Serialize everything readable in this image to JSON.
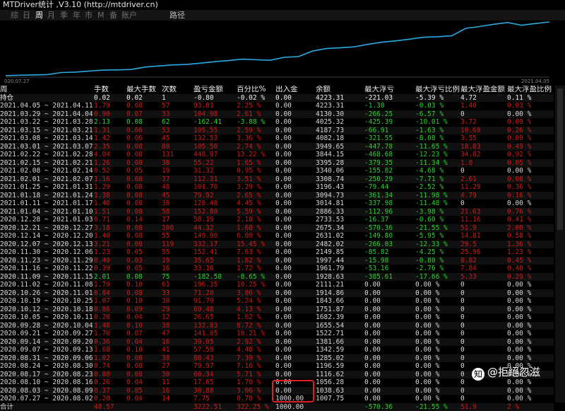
{
  "window": {
    "title": "MTDriver统计 ,V3.10 (http://mtdriver.cn)"
  },
  "tabs": [
    {
      "label": "综",
      "active": false
    },
    {
      "label": "日",
      "active": false
    },
    {
      "label": "周",
      "active": true
    },
    {
      "label": "月",
      "active": false
    },
    {
      "label": "季",
      "active": false
    },
    {
      "label": "年",
      "active": false
    },
    {
      "label": "市",
      "active": false
    },
    {
      "label": "M",
      "active": false
    },
    {
      "label": "备",
      "active": false
    },
    {
      "label": "账户",
      "active": false
    }
  ],
  "extra_tab": "路径",
  "equity_chart": {
    "start_label": "020.07.27",
    "end_label": "2021.04.05",
    "line_color": "#2aa9e0",
    "values": [
      1007.75,
      1038.63,
      1056.28,
      1075.0,
      1196.59,
      1224.6,
      1285.02,
      1342.59,
      1355.32,
      1381.66,
      1522.71,
      1590.53,
      1655.54,
      1682.39,
      1759.66,
      1843.66,
      1914.86,
      1997.03,
      1961.79,
      1928.63,
      2111.21,
      2149.85,
      2482.02,
      2631.02,
      2675.34,
      2733.53,
      2886.33,
      3014.81,
      3094.73,
      3196.43,
      3308.74,
      3340.06,
      3395.28,
      3844.15,
      3949.65,
      4082.18,
      4187.73,
      4025.32,
      4130.3,
      4223.31
    ]
  },
  "table": {
    "headers": [
      "周",
      "手数",
      "最大手数",
      "次数",
      "盈亏金额",
      "百分比%",
      "出入金",
      "余额",
      "最大浮亏",
      "最大浮亏比例",
      "最大浮盈金额",
      "最大浮盈比例"
    ],
    "holding": [
      "持仓",
      "0.02",
      "0.02",
      "1",
      "-0.80",
      "-0.02 %",
      "0.00",
      "4223.31",
      "-221.03",
      "-5.39 %",
      "4.72",
      "0.11 %"
    ],
    "rows": [
      [
        "2021.04.05 ~ 2021.04.11",
        "1.79",
        "0.08",
        "57",
        "93.01",
        "2.25 %",
        "0.00",
        "4223.31",
        "-1.30",
        "-0.03 %",
        "1.40",
        "0.03 %"
      ],
      [
        "2021.03.29 ~ 2021.04.04",
        "0.90",
        "0.07",
        "33",
        "104.98",
        "2.61 %",
        "0.00",
        "4130.30",
        "-266.25",
        "-6.57 %",
        "0",
        "0.00 %"
      ],
      [
        "2021.03.22 ~ 2021.03.28",
        "2.13",
        "0.08",
        "62",
        "-162.41",
        "-3.88 %",
        "0.00",
        "4025.32",
        "-425.39",
        "-10.01 %",
        "3.72",
        "0.09 %"
      ],
      [
        "2021.03.15 ~ 2021.03.21",
        "1.31",
        "0.06",
        "53",
        "105.55",
        "2.59 %",
        "0.00",
        "4187.73",
        "-66.91",
        "-1.63 %",
        "10.69",
        "0.26 %"
      ],
      [
        "2021.03.08 ~ 2021.03.14",
        "1.42",
        "0.06",
        "45",
        "132.53",
        "3.36 %",
        "0.00",
        "4082.18",
        "-321.55",
        "-8.08 %",
        "3.55",
        "0.09 %"
      ],
      [
        "2021.03.01 ~ 2021.03.07",
        "2.35",
        "0.08",
        "80",
        "105.50",
        "2.74 %",
        "0.00",
        "3949.65",
        "-447.78",
        "-11.65 %",
        "18.83",
        "0.49 %"
      ],
      [
        "2021.02.22 ~ 2021.02.28",
        "4.04",
        "0.08",
        "131",
        "448.87",
        "13.22 %",
        "0.00",
        "3844.15",
        "-468.68",
        "-12.23 %",
        "34.82",
        "0.92 %"
      ],
      [
        "2021.02.15 ~ 2021.02.21",
        "1.26",
        "0.08",
        "38",
        "55.22",
        "1.65 %",
        "0.00",
        "3395.28",
        "-379.35",
        "-11.34 %",
        "1.8",
        "0.05 %"
      ],
      [
        "2021.02.08 ~ 2021.02.14",
        "0.52",
        "0.05",
        "19",
        "31.32",
        "0.95 %",
        "0.00",
        "3340.06",
        "-155.82",
        "-4.68 %",
        "0",
        "0.00 %"
      ],
      [
        "2021.02.01 ~ 2021.02.07",
        "1.16",
        "0.08",
        "37",
        "112.31",
        "3.51 %",
        "0.00",
        "3308.74",
        "-250.29",
        "-7.71 %",
        "2.61",
        "0.08 %"
      ],
      [
        "2021.01.25 ~ 2021.01.31",
        "1.29",
        "0.08",
        "48",
        "101.70",
        "3.29 %",
        "0.00",
        "3196.43",
        "-79.44",
        "-2.52 %",
        "11.29",
        "0.36 %"
      ],
      [
        "2021.01.18 ~ 2021.01.24",
        "1.38",
        "0.08",
        "45",
        "79.92",
        "2.65 %",
        "0.00",
        "3094.73",
        "-361.34",
        "-11.98 %",
        "4.79",
        "0.16 %"
      ],
      [
        "2021.01.11 ~ 2021.01.17",
        "1.46",
        "0.08",
        "38",
        "128.48",
        "4.45 %",
        "0.00",
        "3014.81",
        "-337.98",
        "-11.48 %",
        "0",
        "0.00 %"
      ],
      [
        "2021.01.04 ~ 2021.01.10",
        "1.51",
        "0.08",
        "58",
        "152.80",
        "5.59 %",
        "0.00",
        "2886.33",
        "-112.96",
        "-3.98 %",
        "21.63",
        "0.76 %"
      ],
      [
        "2020.12.28 ~ 2021.01.03",
        "0.71",
        "0.14",
        "17",
        "58.19",
        "2.18 %",
        "0.00",
        "2733.53",
        "-16.37",
        "-0.60 %",
        "11.16",
        "0.41 %"
      ],
      [
        "2020.12.21 ~ 2020.12.27",
        "3.18",
        "0.08",
        "106",
        "44.32",
        "1.68 %",
        "0.00",
        "2675.34",
        "-570.36",
        "-21.55 %",
        "51.9",
        "2.00 %"
      ],
      [
        "2020.12.14 ~ 2020.12.20",
        "1.40",
        "0.08",
        "55",
        "149.00",
        "6.00 %",
        "0.00",
        "2631.02",
        "-149.80",
        "-5.95 %",
        "14.81",
        "0.58 %"
      ],
      [
        "2020.12.07 ~ 2020.12.13",
        "3.21",
        "0.08",
        "119",
        "332.17",
        "15.45 %",
        "0.00",
        "2482.02",
        "-266.03",
        "-12.33 %",
        "29.5",
        "1.36 %"
      ],
      [
        "2020.11.30 ~ 2020.12.06",
        "1.23",
        "0.05",
        "55",
        "152.41",
        "7.63 %",
        "0.00",
        "2149.85",
        "-85.82",
        "-4.25 %",
        "25.96",
        "1.23 %"
      ],
      [
        "2020.11.23 ~ 2020.11.29",
        "0.40",
        "0.03",
        "19",
        "35.65",
        "1.82 %",
        "0.00",
        "1997.44",
        "-15.98",
        "-0.80 %",
        "8.82",
        "0.45 %"
      ],
      [
        "2020.11.16 ~ 2020.11.22",
        "0.39",
        "0.05",
        "16",
        "33.16",
        "1.72 %",
        "0.00",
        "1961.79",
        "-53.16",
        "-2.76 %",
        "7.84",
        "0.40 %"
      ],
      [
        "2020.11.09 ~ 2020.11.15",
        "2.01",
        "0.08",
        "75",
        "-182.58",
        "-8.65 %",
        "0.00",
        "1928.63",
        "-385.61",
        "-17.66 %",
        "5.33",
        "0.29 %"
      ],
      [
        "2020.11.02 ~ 2020.11.08",
        "1.79",
        "0.10",
        "61",
        "196.35",
        "10.25 %",
        "0.00",
        "2111.21",
        "0.00",
        "0.00 %",
        "0",
        "0.00 %"
      ],
      [
        "2020.10.26 ~ 2020.11.01",
        "0.84",
        "0.08",
        "33",
        "71.20",
        "3.86 %",
        "0.00",
        "1914.86",
        "0.00",
        "0.00 %",
        "0",
        "0.00 %"
      ],
      [
        "2020.10.19 ~ 2020.10.25",
        "1.07",
        "0.10",
        "30",
        "91.79",
        "5.24 %",
        "0.00",
        "1843.66",
        "0.00",
        "0.00 %",
        "0",
        "0.00 %"
      ],
      [
        "2020.10.12 ~ 2020.10.18",
        "0.86",
        "0.09",
        "29",
        "69.48",
        "4.13 %",
        "0.00",
        "1751.87",
        "0.00",
        "0.00 %",
        "0",
        "0.00 %"
      ],
      [
        "2020.10.05 ~ 2020.10.11",
        "0.28",
        "0.04",
        "12",
        "26.65",
        "1.62 %",
        "0.00",
        "1682.39",
        "0.00",
        "0.00 %",
        "0",
        "0.00 %"
      ],
      [
        "2020.09.28 ~ 2020.10.04",
        "1.48",
        "0.10",
        "38",
        "132.83",
        "8.72 %",
        "0.00",
        "1655.54",
        "0.00",
        "0.00 %",
        "0",
        "0.00 %"
      ],
      [
        "2020.09.21 ~ 2020.09.27",
        "1.70",
        "0.07",
        "47",
        "141.05",
        "10.21 %",
        "0.00",
        "1522.71",
        "0.00",
        "0.00 %",
        "0",
        "0.00 %"
      ],
      [
        "2020.09.14 ~ 2020.09.20",
        "0.36",
        "0.04",
        "16",
        "39.05",
        "2.92 %",
        "0.00",
        "1381.66",
        "0.00",
        "0.00 %",
        "0",
        "0.00 %"
      ],
      [
        "2020.09.07 ~ 2020.09.13",
        "1.68",
        "0.10",
        "41",
        "57.59",
        "4.48 %",
        "0.00",
        "1342.59",
        "0.00",
        "0.00 %",
        "0",
        "0.00 %"
      ],
      [
        "2020.08.31 ~ 2020.09.06",
        "1.02",
        "0.08",
        "38",
        "88.43",
        "7.39 %",
        "0.00",
        "1285.02",
        "0.00",
        "0.00 %",
        "0",
        "0.00 %"
      ],
      [
        "2020.08.24 ~ 2020.08.30",
        "0.74",
        "0.08",
        "27",
        "79.97",
        "7.16 %",
        "0.00",
        "1196.59",
        "0.00",
        "0.00 %",
        "0",
        "0.00 %"
      ],
      [
        "2020.08.17 ~ 2020.08.23",
        "0.80",
        "0.08",
        "30",
        "60.34",
        "5.71 %",
        "0.00",
        "1116.62",
        "0.00",
        "0.00 %",
        "0",
        "0.00 %"
      ],
      [
        "2020.08.10 ~ 2020.08.16",
        "0.26",
        "0.04",
        "11",
        "17.65",
        "1.70 %",
        "0.00",
        "1056.28",
        "0.00",
        "0.00 %",
        "0",
        "0.00 %"
      ],
      [
        "2020.08.03 ~ 2020.08.09",
        "0.37",
        "0.05",
        "16",
        "30.88",
        "3.06 %",
        "0.00",
        "1038.63",
        "0.00",
        "0.00 %",
        "0",
        "0.00 %"
      ],
      [
        "2020.07.27 ~ 2020.08.02",
        "0.20",
        "0.04",
        "14",
        "7.75",
        "0.78 %",
        "1000.00",
        "1007.75",
        "0.00",
        "0.00 %",
        "0",
        "0.00 %"
      ]
    ],
    "total": [
      "合计",
      "48.57",
      "",
      "",
      "3222.51",
      "322.25 %",
      "1000.00",
      "",
      "-570.36",
      "-21.55 %",
      "51.9",
      "2 %"
    ]
  },
  "watermark": {
    "icon": "zhihu-icon",
    "text": "@拒絕忽滋"
  },
  "colors": {
    "profit": "#d11a1a",
    "loss": "#29d42d",
    "neutral": "#d8d8d8",
    "highlight_box": "#e02020"
  }
}
